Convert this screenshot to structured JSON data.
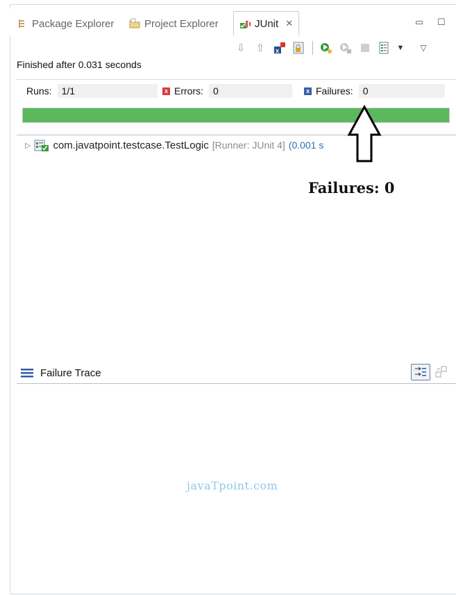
{
  "tabs": [
    {
      "label": "Package Explorer",
      "icon": "package-explorer-icon",
      "active": false
    },
    {
      "label": "Project Explorer",
      "icon": "project-explorer-icon",
      "active": false
    },
    {
      "label": "JUnit",
      "icon": "junit-icon",
      "active": true
    }
  ],
  "junit": {
    "status": "Finished after 0.031 seconds",
    "runs_label": "Runs:",
    "runs_value": "1/1",
    "errors_label": "Errors:",
    "errors_value": "0",
    "failures_label": "Failures:",
    "failures_value": "0",
    "progress": 1.0,
    "progress_color": "#5cb85c"
  },
  "tree": {
    "class_name": "com.javatpoint.testcase.TestLogic",
    "runner": "[Runner: JUnit 4]",
    "time": "(0.001 s"
  },
  "annotation": "Failures: 0",
  "trace": {
    "title": "Failure Trace"
  },
  "watermark": "javaTpoint.com"
}
